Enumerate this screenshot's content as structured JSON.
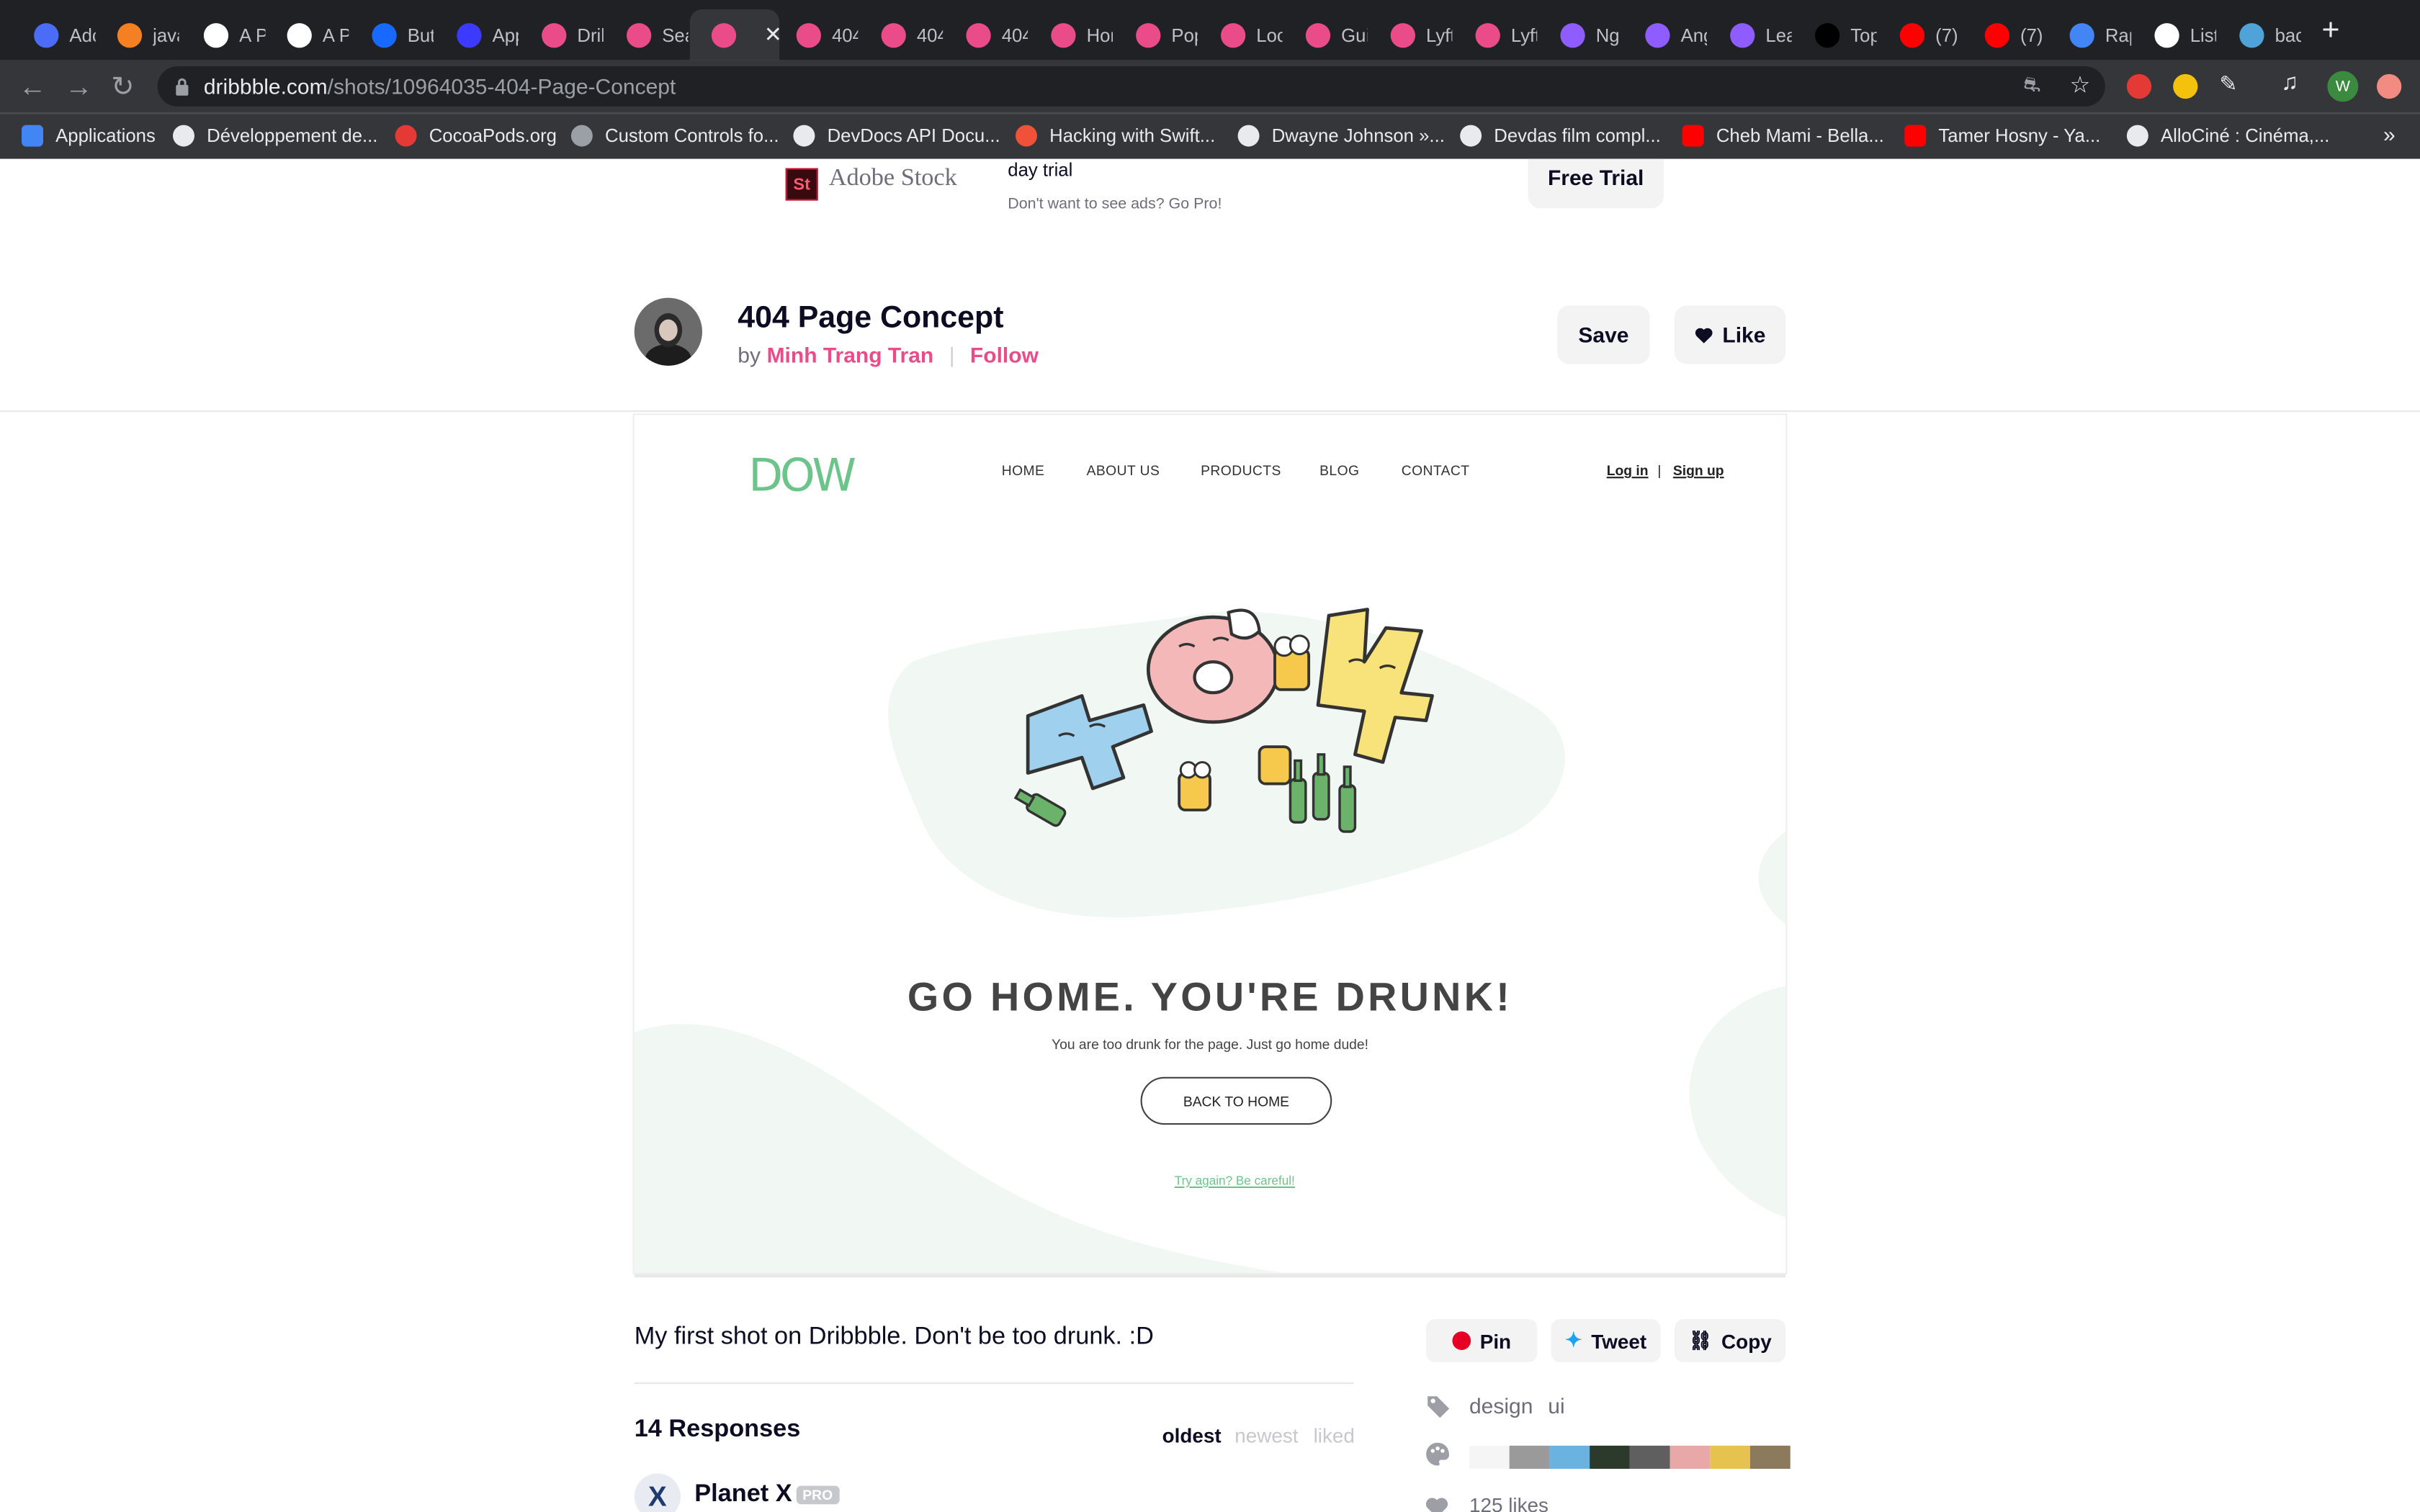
{
  "browser": {
    "tabs": [
      {
        "label": "Adc",
        "icon": "chromium-icon",
        "color": "#4a6cf7"
      },
      {
        "label": "java",
        "icon": "stackoverflow-icon",
        "color": "#f48024"
      },
      {
        "label": "A P",
        "icon": "codepen-icon",
        "color": "#ffffff"
      },
      {
        "label": "A P",
        "icon": "codepen-icon",
        "color": "#ffffff"
      },
      {
        "label": "But",
        "icon": "behance-icon",
        "color": "#1769ff"
      },
      {
        "label": "App",
        "icon": "uplabs-icon",
        "color": "#3d3aff"
      },
      {
        "label": "Drib",
        "icon": "dribbble-icon",
        "color": "#ea4c89"
      },
      {
        "label": "Sea",
        "icon": "dribbble-icon",
        "color": "#ea4c89"
      },
      {
        "label": "",
        "icon": "dribbble-icon",
        "color": "#ea4c89",
        "active": true
      },
      {
        "label": "404",
        "icon": "dribbble-icon",
        "color": "#ea4c89"
      },
      {
        "label": "404",
        "icon": "dribbble-icon",
        "color": "#ea4c89"
      },
      {
        "label": "404",
        "icon": "dribbble-icon",
        "color": "#ea4c89"
      },
      {
        "label": "Hor",
        "icon": "dribbble-icon",
        "color": "#ea4c89"
      },
      {
        "label": "Pop",
        "icon": "dribbble-icon",
        "color": "#ea4c89"
      },
      {
        "label": "Loc",
        "icon": "dribbble-icon",
        "color": "#ea4c89"
      },
      {
        "label": "Gui",
        "icon": "dribbble-icon",
        "color": "#ea4c89"
      },
      {
        "label": "Lyft",
        "icon": "dribbble-icon",
        "color": "#ea4c89"
      },
      {
        "label": "Lyft",
        "icon": "dribbble-icon",
        "color": "#ea4c89"
      },
      {
        "label": "Ng",
        "icon": "angular-icon",
        "color": "#8e5cff"
      },
      {
        "label": "Ang",
        "icon": "angular-icon",
        "color": "#8e5cff"
      },
      {
        "label": "Lea",
        "icon": "angular-icon",
        "color": "#8e5cff"
      },
      {
        "label": "Top",
        "icon": "medium-icon",
        "color": "#000000"
      },
      {
        "label": "(7)",
        "icon": "youtube-icon",
        "color": "#ff0000"
      },
      {
        "label": "(7)",
        "icon": "youtube-icon",
        "color": "#ff0000"
      },
      {
        "label": "Rap",
        "icon": "docs-icon",
        "color": "#4285f4"
      },
      {
        "label": "List",
        "icon": "wikipedia-icon",
        "color": "#ffffff"
      },
      {
        "label": "bac",
        "icon": "image-icon",
        "color": "#4fa3d8"
      }
    ],
    "url_domain": "dribbble.com",
    "url_path": "/shots/10964035-404-Page-Concept",
    "bookmarks": [
      {
        "label": "Applications",
        "icon": "apps-grid-icon"
      },
      {
        "label": "Développement de...",
        "icon": "globe-icon"
      },
      {
        "label": "CocoaPods.org",
        "icon": "cocoapods-icon"
      },
      {
        "label": "Custom Controls fo...",
        "icon": "leaf-icon"
      },
      {
        "label": "DevDocs API Docu...",
        "icon": "globe-icon"
      },
      {
        "label": "Hacking with Swift...",
        "icon": "swift-icon"
      },
      {
        "label": "Dwayne Johnson »...",
        "icon": "globe-icon"
      },
      {
        "label": "Devdas film compl...",
        "icon": "globe-icon"
      },
      {
        "label": "Cheb Mami - Bella...",
        "icon": "youtube-icon"
      },
      {
        "label": "Tamer Hosny - Ya...",
        "icon": "youtube-icon"
      },
      {
        "label": "AlloCiné : Cinéma,...",
        "icon": "globe-icon"
      }
    ],
    "overflow": "»",
    "profile_initial": "W"
  },
  "ad": {
    "brand_logo": "St",
    "brand_name": "Adobe Stock",
    "text": "day trial",
    "subtext": "Don't want to see ads? Go Pro!",
    "cta": "Free Trial"
  },
  "shot": {
    "title": "404 Page Concept",
    "by": "by",
    "author": "Minh Trang Tran",
    "follow": "Follow",
    "save": "Save",
    "like": "Like"
  },
  "mockup": {
    "logo": "DOW",
    "nav": [
      "HOME",
      "ABOUT US",
      "PRODUCTS",
      "BLOG",
      "CONTACT"
    ],
    "login": "Log in",
    "auth_sep": "|",
    "signup": "Sign up",
    "headline": "GO HOME. YOU'RE DRUNK!",
    "subline": "You are too drunk for the page. Just go home dude!",
    "back_button": "BACK TO HOME",
    "retry": "Try again? Be careful!",
    "colors": {
      "accent": "#6dc48a",
      "blob": "#f1f7f2"
    }
  },
  "details": {
    "description": "My first shot on Dribbble. Don't be too drunk. :D",
    "responses_title": "14 Responses",
    "sort": [
      "oldest",
      "newest",
      "liked"
    ],
    "first_commenter": "Planet X",
    "pro_badge": "PRO",
    "share": [
      "Pin",
      "Tweet",
      "Copy"
    ],
    "tags": [
      "design",
      "ui"
    ],
    "palette": [
      "#f5f5f5",
      "#9a9a9a",
      "#6ab2e0",
      "#2c3a2c",
      "#5f5f5f",
      "#e9a8a8",
      "#e6c34f",
      "#8c7a5c"
    ],
    "likes": "125 likes"
  }
}
